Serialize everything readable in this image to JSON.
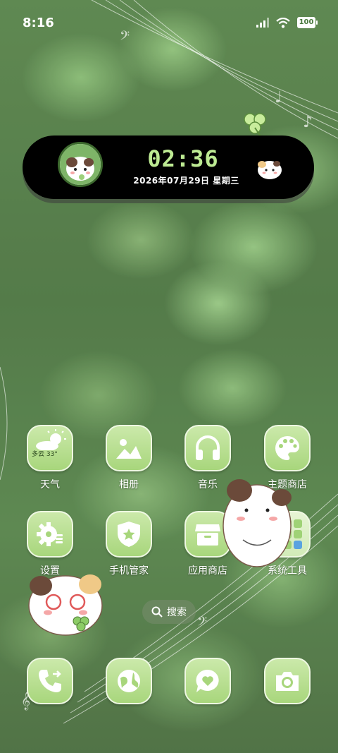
{
  "status_bar": {
    "time": "8:16",
    "battery": "100",
    "signal_icon": "cellular-signal-icon",
    "wifi_icon": "wifi-icon"
  },
  "clock_widget": {
    "time": "02:36",
    "date": "2026年07月29日 星期三",
    "time_color": "#bdea93"
  },
  "apps": {
    "weather": {
      "label": "天气",
      "condition": "多云",
      "temp": "33°",
      "icon": "weather-cloud-sun-icon"
    },
    "gallery": {
      "label": "相册",
      "icon": "mountain-photo-icon"
    },
    "music": {
      "label": "音乐",
      "icon": "headphones-icon"
    },
    "themes": {
      "label": "主题商店",
      "icon": "palette-icon"
    },
    "settings": {
      "label": "设置",
      "icon": "gear-icon"
    },
    "security": {
      "label": "手机管家",
      "icon": "shield-star-icon"
    },
    "app_store": {
      "label": "应用商店",
      "icon": "store-icon"
    },
    "system_tools": {
      "label": "系统工具",
      "icon": "folder-icon"
    }
  },
  "search": {
    "label": "搜索",
    "icon": "search-icon"
  },
  "dock": {
    "phone": {
      "icon": "phone-icon"
    },
    "browser": {
      "icon": "globe-icon"
    },
    "messages": {
      "icon": "message-heart-icon"
    },
    "camera": {
      "icon": "camera-icon"
    }
  },
  "theme": {
    "icon_bg": "#b6dd8c",
    "icon_glyph": "#ffffff",
    "widget_bg": "#000000"
  }
}
